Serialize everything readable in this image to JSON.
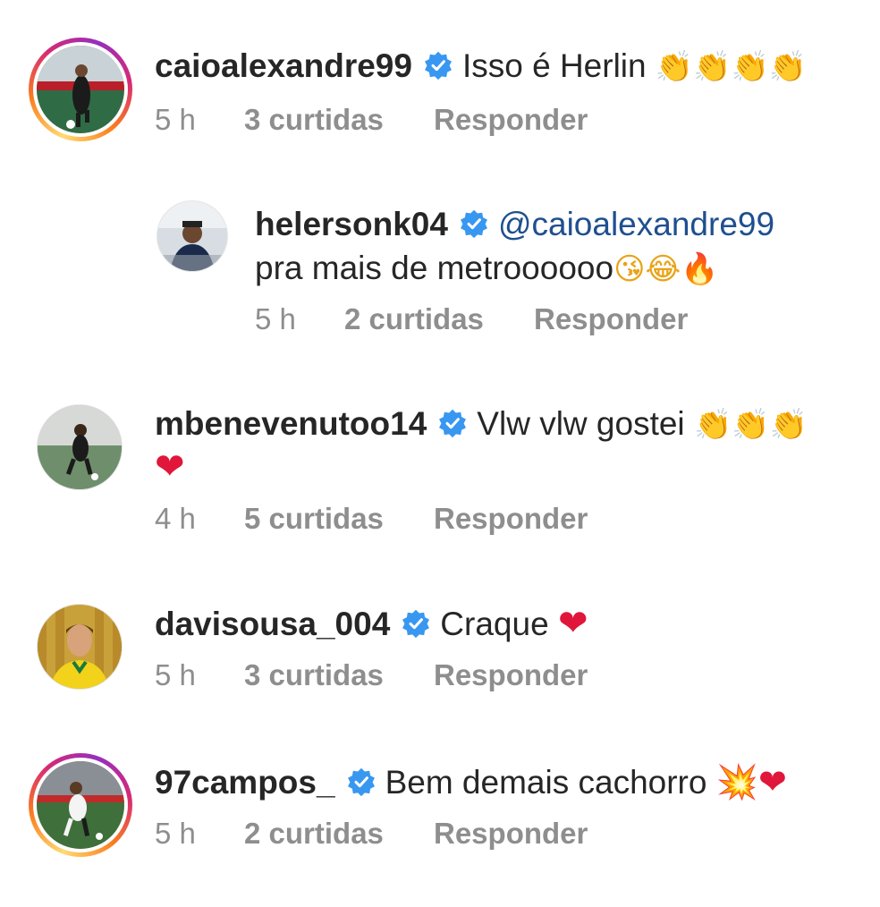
{
  "comments": [
    {
      "username": "caioalexandre99",
      "text": "Isso é Herlin",
      "emoji": "👏👏👏👏",
      "time": "5 h",
      "likes": "3 curtidas",
      "reply": "Responder"
    },
    {
      "username": "helersonk04",
      "mention": "@caioalexandre99",
      "text": "pra mais de metroooooo",
      "emoji": "😘😂🔥",
      "time": "5 h",
      "likes": "2 curtidas",
      "reply": "Responder"
    },
    {
      "username": "mbenevenutoo14",
      "text": "Vlw vlw gostei",
      "emoji": "👏👏👏",
      "emoji2": "❤",
      "time": "4 h",
      "likes": "5 curtidas",
      "reply": "Responder"
    },
    {
      "username": "davisousa_004",
      "text": "Craque",
      "emoji": "❤",
      "time": "5 h",
      "likes": "3 curtidas",
      "reply": "Responder"
    },
    {
      "username": "97campos_",
      "text": "Bem demais cachorro",
      "emoji": "💥❤",
      "time": "5 h",
      "likes": "2 curtidas",
      "reply": "Responder"
    }
  ],
  "icons": {
    "verified": "verified-badge-icon",
    "verified_color": "#3897f0"
  }
}
